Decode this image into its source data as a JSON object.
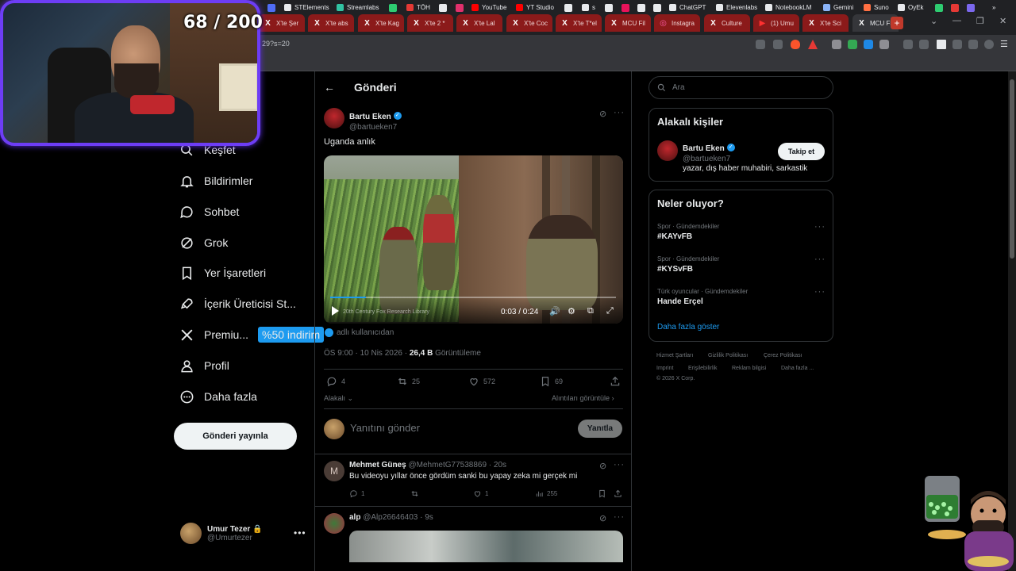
{
  "browser": {
    "tabs": [
      {
        "label": "X'te Şer",
        "icon": "x-logo",
        "active": false
      },
      {
        "label": "X'te abs",
        "icon": "x-logo",
        "active": false
      },
      {
        "label": "X'te Kag",
        "icon": "x-logo",
        "active": false
      },
      {
        "label": "X'te 2 *",
        "icon": "x-logo",
        "active": false
      },
      {
        "label": "X'te Lal",
        "icon": "x-logo",
        "active": false
      },
      {
        "label": "X'te Coc",
        "icon": "x-logo",
        "active": false
      },
      {
        "label": "X'te T*el",
        "icon": "x-logo",
        "active": false
      },
      {
        "label": "MCU Fil",
        "icon": "x-logo",
        "active": false
      },
      {
        "label": "Instagra",
        "icon": "instagram-logo",
        "active": false
      },
      {
        "label": "Culture",
        "icon": "x-logo",
        "active": false
      },
      {
        "label": "(1) Umu",
        "icon": "youtube-logo",
        "active": false
      },
      {
        "label": "X'te Sci",
        "icon": "x-logo",
        "active": false
      },
      {
        "label": "MCU Fil",
        "icon": "x-logo",
        "active": true
      }
    ],
    "new_tab": "+",
    "url": "29?s=20",
    "bookmarks": [
      {
        "label": "STElements",
        "color": "#e8eaed"
      },
      {
        "label": "Streamlabs",
        "color": "#31c3a2"
      },
      {
        "label": "TÖH",
        "color": "#e53935"
      },
      {
        "label": "YouTube",
        "color": "#ff0000"
      },
      {
        "label": "YT Studio",
        "color": "#ff0000"
      },
      {
        "label": "s",
        "color": "#e8eaed"
      },
      {
        "label": "ChatGPT",
        "color": "#e8eaed"
      },
      {
        "label": "Elevenlabs",
        "color": "#e8eaed"
      },
      {
        "label": "NotebookLM",
        "color": "#e8eaed"
      },
      {
        "label": "Gemini",
        "color": "#8ab4f8"
      },
      {
        "label": "Suno",
        "color": "#ff7043"
      },
      {
        "label": "OyEk",
        "color": "#e8eaed"
      }
    ]
  },
  "stream_overlay": {
    "counter": "68 / 200"
  },
  "nav": {
    "items": [
      {
        "label": "Keşfet",
        "icon": "search-icon"
      },
      {
        "label": "Bildirimler",
        "icon": "bell-icon"
      },
      {
        "label": "Sohbet",
        "icon": "chat-icon"
      },
      {
        "label": "Grok",
        "icon": "grok-icon"
      },
      {
        "label": "Yer İşaretleri",
        "icon": "bookmark-icon"
      },
      {
        "label": "İçerik Üreticisi St...",
        "icon": "rocket-icon"
      },
      {
        "label": "Premiu...",
        "icon": "x-logo-icon"
      },
      {
        "label": "Profil",
        "icon": "person-icon"
      },
      {
        "label": "Daha fazla",
        "icon": "more-circle-icon"
      }
    ],
    "premium_badge": "%50 indirim",
    "post_button": "Gönderi yayınla",
    "account": {
      "name": "Umur Tezer",
      "handle": "@Umurtezer"
    }
  },
  "post": {
    "header_title": "Gönderi",
    "author": {
      "name": "Bartu Eken",
      "handle": "@bartueken7"
    },
    "text": "Uganda anlık",
    "video": {
      "time": "0:03 / 0:24",
      "watermark": "20th Century Fox Research Library",
      "progress": 0.125
    },
    "source": "adlı kullanıcıdan",
    "timestamp": "ÖS 9:00 · 10 Nis 2026 · ",
    "views": "26,4 B",
    "views_label": " Görüntüleme",
    "stats": {
      "replies": "4",
      "reposts": "25",
      "likes": "572",
      "bookmarks": "69"
    },
    "relevant_label": "Alakalı",
    "quotes_label": "Alıntıları görüntüle",
    "reply_placeholder": "Yanıtını gönder",
    "reply_button": "Yanıtla"
  },
  "replies": [
    {
      "name": "Mehmet Güneş",
      "handle": "@MehmetG77538869",
      "time": "· 20s",
      "text": "Bu videoyu yıllar önce gördüm sanki bu yapay zeka mi gerçek mi",
      "stats": {
        "replies": "1",
        "reposts": "",
        "likes": "1",
        "views": "255"
      },
      "avatar_letter": "M"
    },
    {
      "name": "alp",
      "handle": "@Alp26646403",
      "time": "· 9s"
    }
  ],
  "sidebar": {
    "search_placeholder": "Ara",
    "relevant_people": {
      "title": "Alakalı kişiler",
      "name": "Bartu Eken",
      "handle": "@bartueken7",
      "bio": "yazar, dış haber muhabiri, sarkastik",
      "follow_button": "Takip et"
    },
    "trends": {
      "title": "Neler oluyor?",
      "items": [
        {
          "category": "Spor · Gündemdekiler",
          "name": "#KAYvFB"
        },
        {
          "category": "Spor · Gündemdekiler",
          "name": "#KYSvFB"
        },
        {
          "category": "Türk oyuncular · Gündemdekiler",
          "name": "Hande Erçel"
        }
      ],
      "show_more": "Daha fazla göster"
    },
    "footer": {
      "links": [
        "Hizmet Şartları",
        "Gizlilik Politikası",
        "Çerez Politikası",
        "Imprint",
        "Erişilebilirlik",
        "Reklam bilgisi",
        "Daha fazla ..."
      ],
      "copyright": "© 2026 X Corp."
    }
  },
  "colors": {
    "accent": "#1d9bf0",
    "background": "#000000",
    "border": "#2f3336",
    "webcam_border": "#6d3df5",
    "tab_red": "#8b1a1a"
  }
}
